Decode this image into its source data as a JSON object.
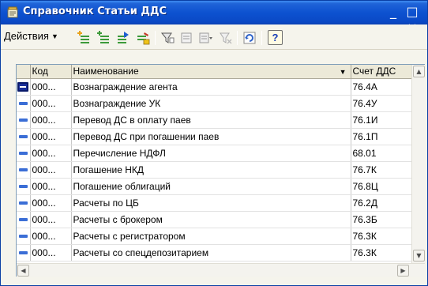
{
  "window": {
    "title": "Справочник Статьи ДДС",
    "minimize_glyph": "_",
    "close_glyph": "□ ×"
  },
  "toolbar": {
    "actions_label": "Действия",
    "icons": [
      "add-icon",
      "add-group-icon",
      "copy-icon",
      "edit-icon",
      "filter-icon",
      "filter-list-icon",
      "filter-dropdown-icon",
      "clear-filter-icon",
      "refresh-icon",
      "help-icon"
    ],
    "help_label": "?"
  },
  "table": {
    "columns": [
      "Код",
      "Наименование",
      "Счет ДДС"
    ],
    "rows": [
      {
        "code": "000...",
        "name": "Вознаграждение агента",
        "account": "76.4А"
      },
      {
        "code": "000...",
        "name": "Вознаграждение УК",
        "account": "76.4У"
      },
      {
        "code": "000...",
        "name": "Перевод ДС в оплату паев",
        "account": "76.1И"
      },
      {
        "code": "000...",
        "name": "Перевод ДС при погашении паев",
        "account": "76.1П"
      },
      {
        "code": "000...",
        "name": "Перечисление НДФЛ",
        "account": "68.01"
      },
      {
        "code": "000...",
        "name": "Погашение НКД",
        "account": "76.7К"
      },
      {
        "code": "000...",
        "name": "Погашение облигаций",
        "account": "76.8Ц"
      },
      {
        "code": "000...",
        "name": "Расчеты по ЦБ",
        "account": "76.2Д"
      },
      {
        "code": "000...",
        "name": "Расчеты с брокером",
        "account": "76.3Б"
      },
      {
        "code": "000...",
        "name": "Расчеты с регистратором",
        "account": "76.3К"
      },
      {
        "code": "000...",
        "name": "Расчеты со спецдепозитарием",
        "account": "76.3К"
      }
    ],
    "selected_row": 0
  },
  "colors": {
    "titlebar": "#0a48c5",
    "row_marker": "#3b6ed6",
    "selected_marker": "#1a2f9a"
  }
}
